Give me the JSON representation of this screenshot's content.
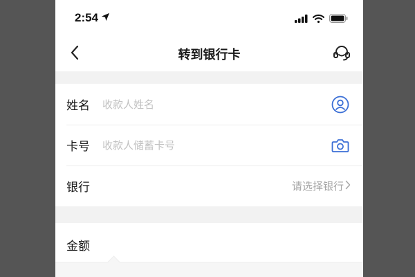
{
  "status_bar": {
    "time": "2:54",
    "icons": [
      "location-arrow-icon",
      "signal-icon",
      "wifi-icon",
      "battery-icon"
    ]
  },
  "nav": {
    "title": "转到银行卡",
    "back_icon": "chevron-left-icon",
    "support_icon": "headset-icon"
  },
  "form": {
    "name": {
      "label": "姓名",
      "placeholder": "收款人姓名",
      "icon": "contact-person-icon"
    },
    "card": {
      "label": "卡号",
      "placeholder": "收款人储蓄卡号",
      "icon": "camera-icon"
    },
    "bank": {
      "label": "银行",
      "value": "请选择银行",
      "icon": "chevron-right-icon"
    }
  },
  "amount": {
    "label": "金额"
  },
  "colors": {
    "accent": "#3b6fd6",
    "background": "#f2f2f2",
    "surround": "#555555"
  }
}
